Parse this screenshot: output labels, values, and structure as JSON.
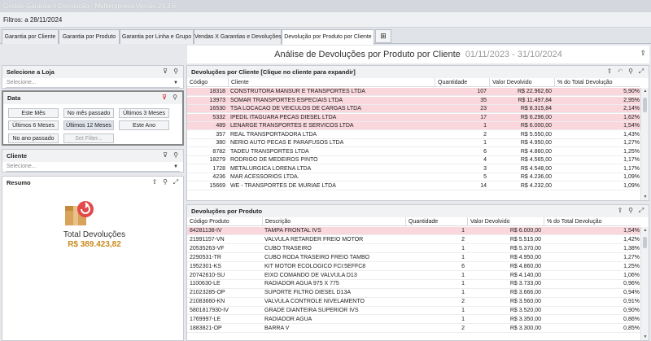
{
  "window": {
    "title": "Gestão Garantia e Devolução - Multiempresa Versão 24.3.6"
  },
  "filtros": {
    "label": "Filtros:",
    "value": "a 28/11/2024"
  },
  "tabs": [
    {
      "label": "Garantia por Cliente"
    },
    {
      "label": "Garantia por Produto"
    },
    {
      "label": "Garantia por Linha e Grupo"
    },
    {
      "label": "Vendas X Garantias e Devoluções"
    },
    {
      "label": "Devolução por Produto por Cliente"
    }
  ],
  "header": {
    "title": "Análise de Devoluções por Produto por Cliente",
    "period": "01/11/2023 - 31/10/2024"
  },
  "loja": {
    "title": "Selecione a Loja",
    "placeholder": "Selecione..."
  },
  "data_panel": {
    "title": "Data",
    "buttons": [
      "Este Mês",
      "No mês passado",
      "Últimos 3 Meses",
      "Últimos 6 Meses",
      "Últimos 12 Meses",
      "Este Ano",
      "No ano passado",
      "Set Filter..."
    ],
    "selected": "Últimos 12 Meses"
  },
  "cliente": {
    "title": "Cliente",
    "placeholder": "Selecione..."
  },
  "resumo": {
    "title": "Resumo",
    "total_label": "Total Devoluções",
    "total_value": "R$ 389.423,82"
  },
  "clientes_grid": {
    "title": "Devoluções por Cliente [Clique no cliente para expandir]",
    "columns": [
      "Código",
      "Cliente",
      "Quantidade",
      "Valor Devolvido",
      "% do Total Devolução"
    ],
    "rows": [
      {
        "codigo": "18318",
        "cliente": "CONSTRUTORA MANSUR E TRANSPORTES LTDA",
        "qtd": "107",
        "valor": "R$ 22.962,60",
        "pct": "5,90%",
        "hl": true
      },
      {
        "codigo": "13973",
        "cliente": "SOMAR TRANSPORTES ESPECIAIS LTDA",
        "qtd": "35",
        "valor": "R$ 11.497,84",
        "pct": "2,95%",
        "hl": true
      },
      {
        "codigo": "16530",
        "cliente": "TSA LOCACAO DE VEICULOS DE CARGAS LTDA",
        "qtd": "23",
        "valor": "R$ 8.315,84",
        "pct": "2,14%",
        "hl": true
      },
      {
        "codigo": "5332",
        "cliente": "IPEDIL ITAGUARA PECAS DIESEL LTDA",
        "qtd": "17",
        "valor": "R$ 6.296,00",
        "pct": "1,62%",
        "hl": true
      },
      {
        "codigo": "489",
        "cliente": "LENARGE TRANSPORTES E SERVICOS LTDA",
        "qtd": "1",
        "valor": "R$ 6.000,00",
        "pct": "1,54%",
        "hl": true
      },
      {
        "codigo": "357",
        "cliente": "REAL TRANSPORTADORA LTDA",
        "qtd": "2",
        "valor": "R$ 5.550,00",
        "pct": "1,43%",
        "hl": false
      },
      {
        "codigo": "380",
        "cliente": "NERIO AUTO PECAS E PARAFUSOS LTDA",
        "qtd": "1",
        "valor": "R$ 4.950,00",
        "pct": "1,27%",
        "hl": false
      },
      {
        "codigo": "8782",
        "cliente": "TADEU TRANSPORTES LTDA",
        "qtd": "6",
        "valor": "R$ 4.860,00",
        "pct": "1,25%",
        "hl": false
      },
      {
        "codigo": "18279",
        "cliente": "RODRIGO DE MEDEIROS PINTO",
        "qtd": "4",
        "valor": "R$ 4.565,00",
        "pct": "1,17%",
        "hl": false
      },
      {
        "codigo": "1728",
        "cliente": "METALURGICA LORENA LTDA",
        "qtd": "3",
        "valor": "R$ 4.548,00",
        "pct": "1,17%",
        "hl": false
      },
      {
        "codigo": "4236",
        "cliente": "MAR ACESSORIOS LTDA.",
        "qtd": "5",
        "valor": "R$ 4.236,00",
        "pct": "1,09%",
        "hl": false
      },
      {
        "codigo": "15669",
        "cliente": "WE - TRANSPORTES DE MURIAE LTDA",
        "qtd": "14",
        "valor": "R$ 4.232,00",
        "pct": "1,09%",
        "hl": false
      }
    ]
  },
  "produtos_grid": {
    "title": "Devoluções por Produto",
    "columns": [
      "Código Produto",
      "Descrição",
      "Quantidade",
      "Valor Devolvido",
      "% do Total Devolução"
    ],
    "rows": [
      {
        "codigo": "84281138-IV",
        "desc": "TAMPA FRONTAL IVS",
        "qtd": "1",
        "valor": "R$ 6.000,00",
        "pct": "1,54%",
        "hl": true
      },
      {
        "codigo": "21991157-VN",
        "desc": "VALVULA RETARDER FREIO MOTOR",
        "qtd": "2",
        "valor": "R$ 5.515,00",
        "pct": "1,42%",
        "hl": false
      },
      {
        "codigo": "20535263-VF",
        "desc": "CUBO TRASEIRO",
        "qtd": "1",
        "valor": "R$ 5.370,00",
        "pct": "1,38%",
        "hl": false
      },
      {
        "codigo": "2290531-TR",
        "desc": "CUBO RODA TRASEIRO FREIO TAMBO",
        "qtd": "1",
        "valor": "R$ 4.950,00",
        "pct": "1,27%",
        "hl": false
      },
      {
        "codigo": "1952301-KS",
        "desc": "KIT MOTOR ECOLOGICO FCI:5EFFC8",
        "qtd": "6",
        "valor": "R$ 4.860,00",
        "pct": "1,25%",
        "hl": false
      },
      {
        "codigo": "20742610-SU",
        "desc": "EIXO COMANDO DE VALVULA D13",
        "qtd": "1",
        "valor": "R$ 4.140,00",
        "pct": "1,06%",
        "hl": false
      },
      {
        "codigo": "1100630-LE",
        "desc": "RADIADOR AGUA 975 X 775",
        "qtd": "1",
        "valor": "R$ 3.733,00",
        "pct": "0,96%",
        "hl": false
      },
      {
        "codigo": "21023285-OP",
        "desc": "SUPORTE FILTRO DIESEL D13A",
        "qtd": "1",
        "valor": "R$ 3.666,00",
        "pct": "0,94%",
        "hl": false
      },
      {
        "codigo": "21083660-KN",
        "desc": "VALVULA CONTROLE NIVELAMENTO",
        "qtd": "2",
        "valor": "R$ 3.560,00",
        "pct": "0,91%",
        "hl": false
      },
      {
        "codigo": "5801817930-IV",
        "desc": "GRADE DIANTEIRA SUPERIOR IVS",
        "qtd": "1",
        "valor": "R$ 3.520,00",
        "pct": "0,90%",
        "hl": false
      },
      {
        "codigo": "1769997-LE",
        "desc": "RADIADOR AGUA",
        "qtd": "1",
        "valor": "R$ 3.350,00",
        "pct": "0,86%",
        "hl": false
      },
      {
        "codigo": "1883821-OP",
        "desc": "BARRA V",
        "qtd": "2",
        "valor": "R$ 3.300,00",
        "pct": "0,85%",
        "hl": false
      }
    ]
  }
}
